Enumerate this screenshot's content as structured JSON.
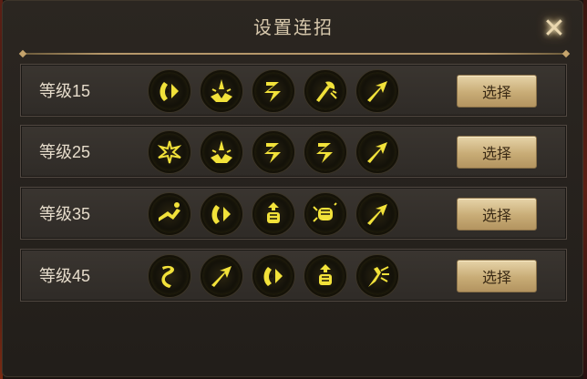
{
  "dialog": {
    "title": "设置连招",
    "close_icon": "close-x-icon"
  },
  "rows": [
    {
      "label": "等级15",
      "skills": [
        "pull-strike-icon",
        "ground-slam-icon",
        "double-slash-icon",
        "axe-strike-icon",
        "dash-arrow-icon"
      ],
      "button": "选择"
    },
    {
      "label": "等级25",
      "skills": [
        "shatter-icon",
        "ground-slam-icon",
        "double-slash-icon",
        "double-slash-icon",
        "dash-arrow-icon"
      ],
      "button": "选择"
    },
    {
      "label": "等级35",
      "skills": [
        "sliding-kick-icon",
        "pull-strike-icon",
        "fist-up-icon",
        "punch-icon",
        "dash-arrow-icon"
      ],
      "button": "选择"
    },
    {
      "label": "等级45",
      "skills": [
        "whirlwind-icon",
        "dash-arrow-icon",
        "pull-strike-icon",
        "fist-up-icon",
        "burst-kick-icon"
      ],
      "button": "选择"
    }
  ],
  "colors": {
    "icon_glow": "#f2e23a",
    "button_gold": "#c8ac76",
    "panel_bg": "#2b2621"
  }
}
